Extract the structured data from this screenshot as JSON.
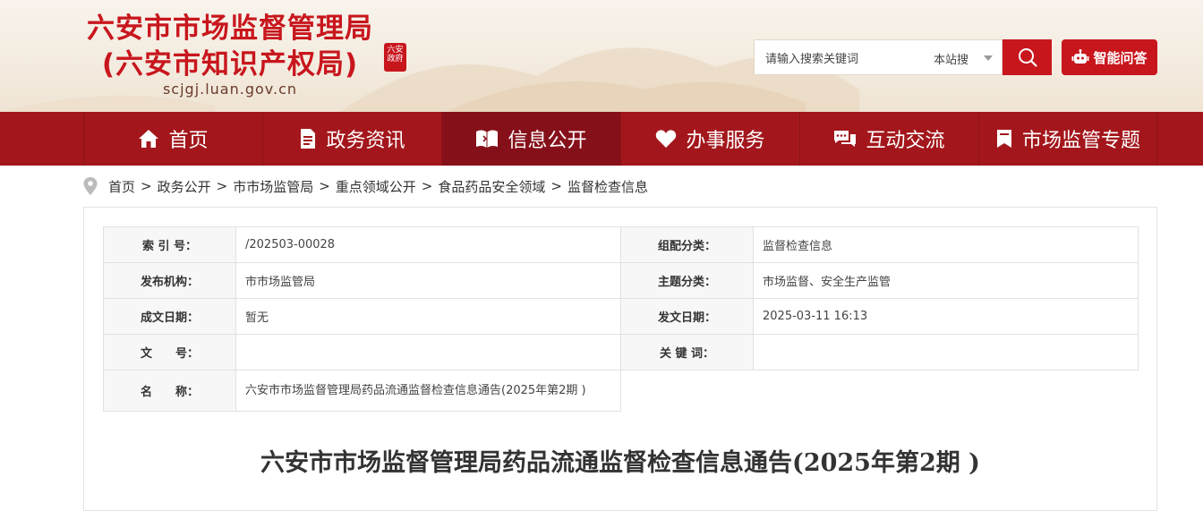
{
  "header": {
    "title_line1": "六安市市场监督管理局",
    "title_line2": "(六安市知识产权局)",
    "domain": "scjgj.luan.gov.cn",
    "seal_text": "六安政府",
    "search_placeholder": "请输入搜索关键词",
    "search_scope": "本站搜",
    "ai_button": "智能问答"
  },
  "nav": {
    "items": [
      {
        "label": "首页",
        "icon": "home-icon"
      },
      {
        "label": "政务资讯",
        "icon": "document-icon"
      },
      {
        "label": "信息公开",
        "icon": "open-book-icon"
      },
      {
        "label": "办事服务",
        "icon": "heart-icon"
      },
      {
        "label": "互动交流",
        "icon": "chat-icon"
      },
      {
        "label": "市场监管专题",
        "icon": "bookmark-icon"
      }
    ],
    "active_index": 2
  },
  "breadcrumb": [
    "首页",
    "政务公开",
    "市市场监管局",
    "重点领域公开",
    "食品药品安全领域",
    "监督检查信息"
  ],
  "meta": {
    "index_label": "索 引 号：",
    "index_value": "/202503-00028",
    "category_label": "组配分类：",
    "category_value": "监督检查信息",
    "publisher_label": "发布机构：",
    "publisher_value": "市市场监管局",
    "topic_label": "主题分类：",
    "topic_value": "市场监督、安全生产监管",
    "created_label": "成文日期：",
    "created_value": "暂无",
    "published_label": "发文日期：",
    "published_value": "2025-03-11 16:13",
    "docno_label": "文　　号：",
    "docno_value": "",
    "keywords_label": "关 键 词：",
    "keywords_value": "",
    "name_label": "名　　称：",
    "name_value": "六安市市场监督管理局药品流通监督检查信息通告(2025年第2期 )"
  },
  "document": {
    "title": "六安市市场监督管理局药品流通监督检查信息通告(2025年第2期 )"
  },
  "colors": {
    "brand_red": "#c8161d",
    "nav_red": "#a3171c",
    "nav_active": "#86101a"
  }
}
